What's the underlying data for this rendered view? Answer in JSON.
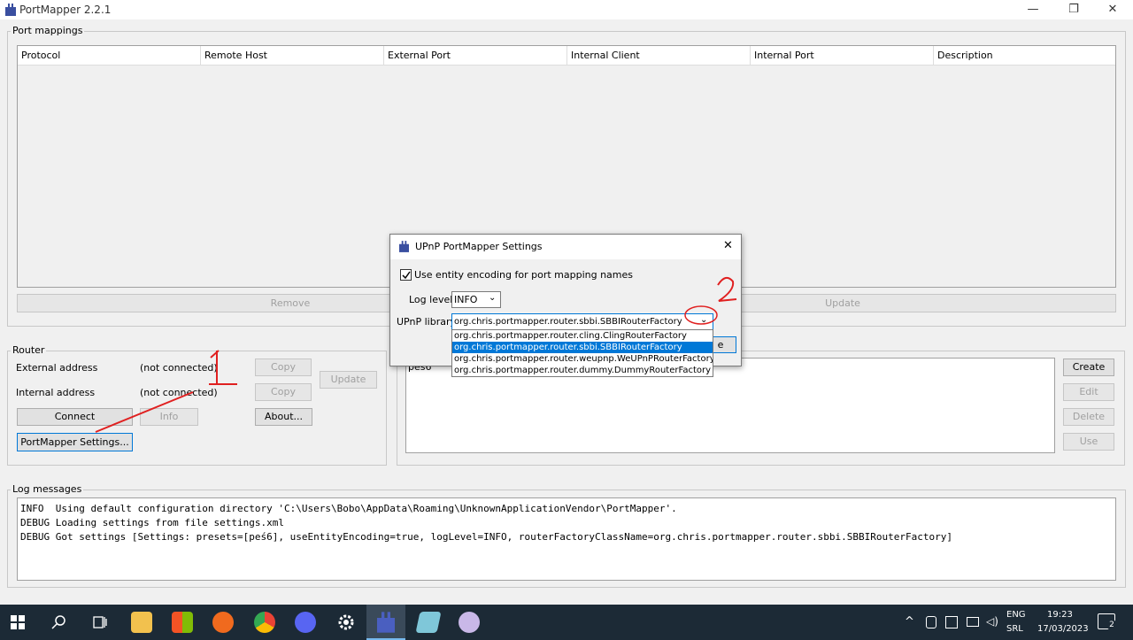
{
  "window": {
    "title": "PortMapper 2.2.1",
    "minimize": "—",
    "restore": "❐",
    "close": "✕"
  },
  "port_mappings": {
    "group_label": "Port mappings",
    "columns": [
      "Protocol",
      "Remote Host",
      "External Port",
      "Internal Client",
      "Internal Port",
      "Description"
    ],
    "remove_label": "Remove",
    "update_label": "Update"
  },
  "router": {
    "group_label": "Router",
    "external_label": "External address",
    "external_value": "(not connected)",
    "internal_label": "Internal address",
    "internal_value": "(not connected)",
    "copy_label": "Copy",
    "update_label": "Update",
    "connect_label": "Connect",
    "info_label": "Info",
    "about_label": "About...",
    "settings_label": "PortMapper Settings..."
  },
  "presets": {
    "items": [
      "peś6"
    ],
    "create_label": "Create",
    "edit_label": "Edit",
    "delete_label": "Delete",
    "use_label": "Use"
  },
  "log": {
    "group_label": "Log messages",
    "lines": [
      "INFO  Using default configuration directory 'C:\\Users\\Bobo\\AppData\\Roaming\\UnknownApplicationVendor\\PortMapper'.",
      "DEBUG Loading settings from file settings.xml",
      "DEBUG Got settings [Settings: presets=[peś6], useEntityEncoding=true, logLevel=INFO, routerFactoryClassName=org.chris.portmapper.router.sbbi.SBBIRouterFactory]"
    ]
  },
  "dialog": {
    "title": "UPnP PortMapper Settings",
    "close_icon": "✕",
    "entity_encoding_label": "Use entity encoding for port mapping names",
    "entity_encoding_checked": true,
    "log_level_label": "Log level",
    "log_level_value": "INFO",
    "upnp_library_label": "UPnP library",
    "upnp_library_value": "org.chris.portmapper.router.sbbi.SBBIRouterFactory",
    "upnp_library_options": [
      "org.chris.portmapper.router.cling.ClingRouterFactory",
      "org.chris.portmapper.router.sbbi.SBBIRouterFactory",
      "org.chris.portmapper.router.weupnp.WeUPnPRouterFactory",
      "org.chris.portmapper.router.dummy.DummyRouterFactory"
    ],
    "selected_option_index": 1,
    "hidden_button_fragment": "e"
  },
  "annotations": {
    "mark_1": "1",
    "mark_2": "2",
    "color": "#e02020"
  },
  "taskbar": {
    "icons": [
      "windows-start-icon",
      "search-icon",
      "task-view-icon",
      "file-explorer-icon",
      "store-icon",
      "app-icon",
      "chrome-icon",
      "discord-icon",
      "settings-icon",
      "portmapper-icon",
      "notepad-icon",
      "paint-icon"
    ],
    "language": "ENG",
    "layout": "SRL",
    "time": "19:23",
    "date": "17/03/2023",
    "notifications": "2"
  }
}
